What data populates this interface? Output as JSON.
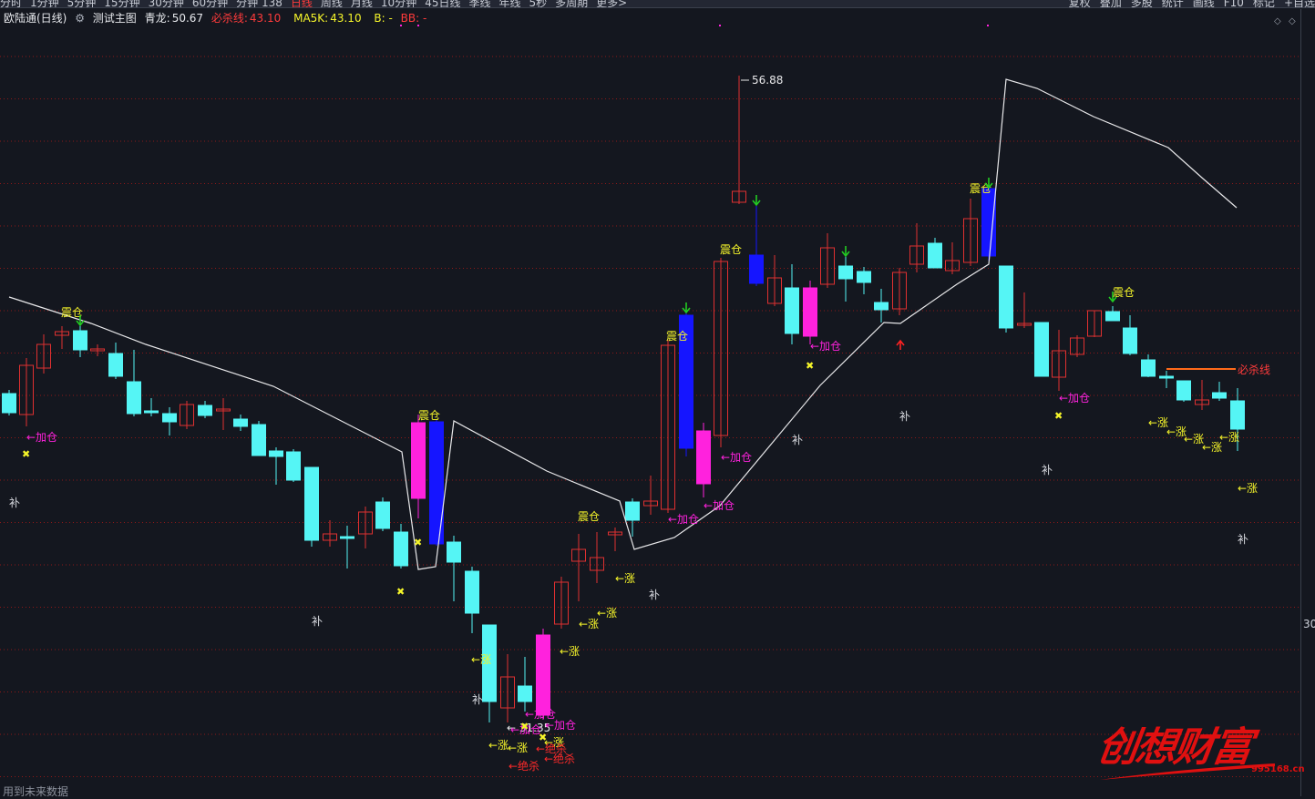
{
  "toolbar": {
    "periods": [
      "分时",
      "1分钟",
      "5分钟",
      "15分钟",
      "30分钟",
      "60分钟",
      "分钟 138",
      "日线",
      "周线",
      "月线",
      "10分钟",
      "45日线",
      "季线",
      "年线",
      "5秒",
      "多周期",
      "更多>"
    ],
    "active_period": "日线",
    "right_items": [
      "复权",
      "叠加",
      "多股",
      "统计",
      "画线",
      "F10",
      "标记",
      "+自选"
    ]
  },
  "header": {
    "stock": "欧陆通(日线)",
    "indicator": "测试主图",
    "qinglong_label": "青龙:",
    "qinglong_value": "50.67",
    "bisha_label": "必杀线:",
    "bisha_value": "43.10",
    "ma5k_label": "MA5K:",
    "ma5k_value": "43.10",
    "b_label": "B: -",
    "bb_label": "BB: -"
  },
  "colors": {
    "background": "#14171f",
    "up": "#e03030",
    "down": "#55f5f5",
    "magenta": "#ff22dd",
    "blue": "#1515ff",
    "yellow": "#f5f52a",
    "grid": "#8c1818"
  },
  "chart_data": {
    "type": "candlestick",
    "high_label": "56.88",
    "low_label": "← 31.35",
    "axis_tick": "30",
    "bisha_label": "必杀线"
  },
  "markers": {
    "zhencang": "震仓",
    "jiacang": "←加仓",
    "zhang": "←涨",
    "juesha": "←绝杀",
    "bu": "补"
  },
  "watermark": {
    "text": "创想财富",
    "url": "995168.cn"
  },
  "footer": {
    "text": "用到未来数据"
  }
}
